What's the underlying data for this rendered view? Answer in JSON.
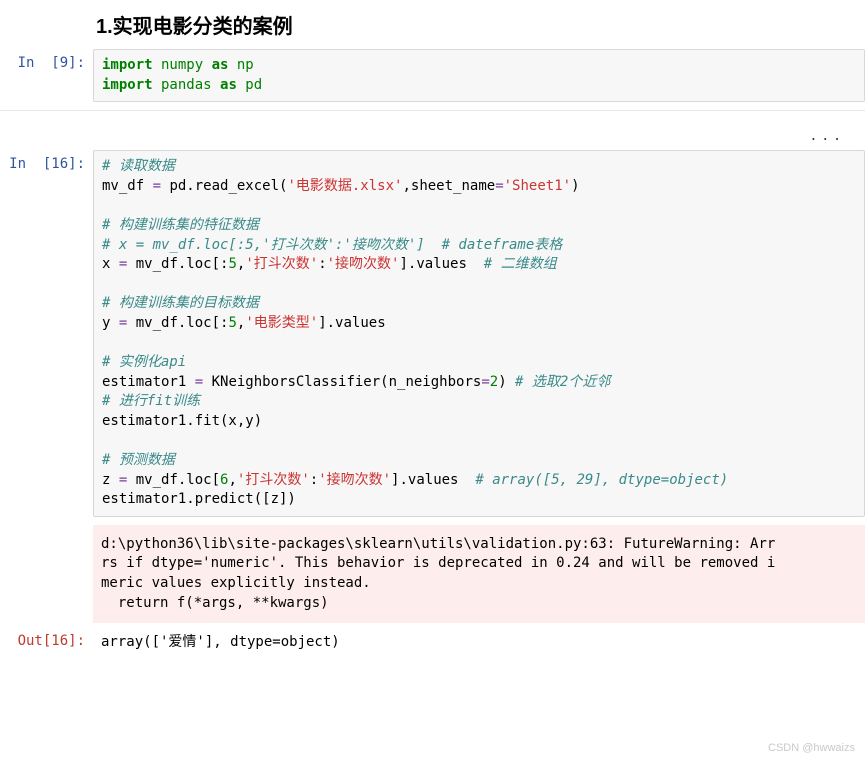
{
  "title": "1.实现电影分类的案例",
  "cell1": {
    "prompt": "In  [9]:",
    "l1a": "import",
    "l1b": " numpy ",
    "l1c": "as",
    "l1d": " np",
    "l2a": "import",
    "l2b": " pandas ",
    "l2c": "as",
    "l2d": " pd"
  },
  "ellipsis": "...",
  "cell2": {
    "prompt": "In  [16]:",
    "c1": "# 读取数据",
    "l2a": "mv_df ",
    "l2b": "=",
    "l2c": " pd.read_excel(",
    "l2d": "'电影数据.xlsx'",
    "l2e": ",sheet_name",
    "l2f": "=",
    "l2g": "'Sheet1'",
    "l2h": ")",
    "c3": "# 构建训练集的特征数据",
    "c4": "# x = mv_df.loc[:5,'打斗次数':'接吻次数']  # dateframe表格",
    "l5a": "x ",
    "l5b": "=",
    "l5c": " mv_df.loc[:",
    "l5d": "5",
    "l5e": ",",
    "l5f": "'打斗次数'",
    "l5g": ":",
    "l5h": "'接吻次数'",
    "l5i": "].values  ",
    "c5j": "# 二维数组",
    "c6": "# 构建训练集的目标数据",
    "l7a": "y ",
    "l7b": "=",
    "l7c": " mv_df.loc[:",
    "l7d": "5",
    "l7e": ",",
    "l7f": "'电影类型'",
    "l7g": "].values",
    "c8": "# 实例化api",
    "l9a": "estimator1 ",
    "l9b": "=",
    "l9c": " KNeighborsClassifier(n_neighbors",
    "l9d": "=",
    "l9e": "2",
    "l9f": ") ",
    "c9g": "# 选取2个近邻",
    "c10": "# 进行fit训练",
    "l11": "estimator1.fit(x,y)",
    "c12": "# 预测数据",
    "l13a": "z ",
    "l13b": "=",
    "l13c": " mv_df.loc[",
    "l13d": "6",
    "l13e": ",",
    "l13f": "'打斗次数'",
    "l13g": ":",
    "l13h": "'接吻次数'",
    "l13i": "].values  ",
    "c13j": "# array([5, 29], dtype=object)",
    "l14": "estimator1.predict([z])"
  },
  "stderr": {
    "l1": "d:\\python36\\lib\\site-packages\\sklearn\\utils\\validation.py:63: FutureWarning: Arr",
    "l2": "rs if dtype='numeric'. This behavior is deprecated in 0.24 and will be removed i",
    "l3": "meric values explicitly instead.",
    "l4": "  return f(*args, **kwargs)"
  },
  "out": {
    "prompt": "Out[16]:",
    "text": "array(['爱情'], dtype=object)"
  },
  "watermark": "CSDN @hwwaizs"
}
